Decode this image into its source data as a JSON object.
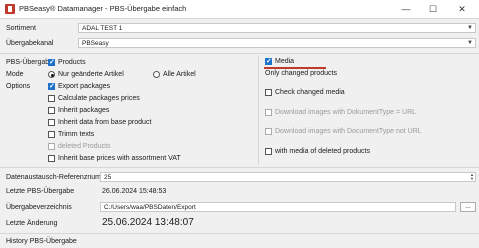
{
  "window": {
    "title": "PBSeasy® Datamanager - PBS-Übergabe einfach",
    "controls": [
      "—",
      "☐",
      "✕"
    ]
  },
  "sortiment": {
    "label": "Sortiment",
    "value": "ADAL TEST 1"
  },
  "uebergabekanal": {
    "label": "Übergabekanal",
    "value": "PBSeasy"
  },
  "pbs_uebergabe": {
    "label": "PBS-Übergabe",
    "products_label": "Products",
    "products_checked": true,
    "mode_label": "Mode",
    "mode_options": [
      "Nur geänderte Artikel",
      "Alle Artikel"
    ],
    "mode_selected": "Nur geänderte Artikel",
    "options_label": "Options",
    "options": [
      {
        "label": "Export packages",
        "checked": true,
        "disabled": false
      },
      {
        "label": "Calculate packages prices",
        "checked": false,
        "disabled": false
      },
      {
        "label": "Inherit packages",
        "checked": false,
        "disabled": false
      },
      {
        "label": "Inherit data from base product",
        "checked": false,
        "disabled": false
      },
      {
        "label": "Trimm texts",
        "checked": false,
        "disabled": false
      },
      {
        "label": "deleted Products",
        "checked": false,
        "disabled": true
      },
      {
        "label": "Inherit base prices with assortment VAT",
        "checked": false,
        "disabled": false
      }
    ]
  },
  "media": {
    "label": "Media",
    "checked": true,
    "mode_text": "Only changed products",
    "accent_color": "#c0392b",
    "options": [
      {
        "label": "Check changed media",
        "checked": false,
        "disabled": false
      },
      {
        "label": "Download images with DokumentType = URL",
        "checked": false,
        "disabled": true
      },
      {
        "label": "Download images with DocumentType not URL",
        "checked": false,
        "disabled": true
      },
      {
        "label": "with media of deleted products",
        "checked": false,
        "disabled": false
      }
    ]
  },
  "referenznummer": {
    "label": "Datenaustausch-Referenznummer",
    "value": "25"
  },
  "letzte_uebergabe": {
    "label": "Letzte PBS-Übergabe",
    "value": "26.06.2024 15:48:53"
  },
  "uebergabeverzeichnis": {
    "label": "Übergabeverzeichnis",
    "value": "C:/Users/waa/PBSDaten/Export",
    "browse_label": "..."
  },
  "letzte_aenderung": {
    "label": "Letzte Änderung",
    "value": "25.06.2024 13:48:07"
  },
  "history": {
    "label": "History PBS-Übergabe"
  }
}
